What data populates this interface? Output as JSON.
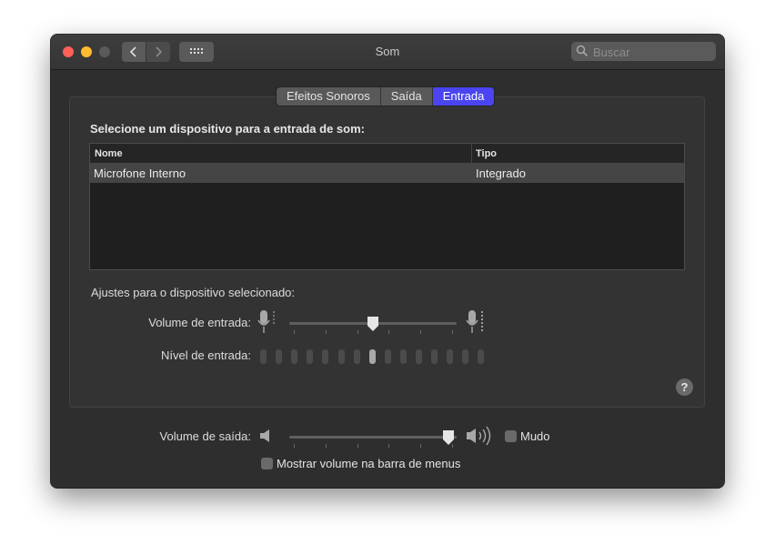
{
  "window": {
    "title": "Som"
  },
  "search": {
    "placeholder": "Buscar"
  },
  "tabs": [
    {
      "label": "Efeitos Sonoros",
      "active": false
    },
    {
      "label": "Saída",
      "active": false
    },
    {
      "label": "Entrada",
      "active": true
    }
  ],
  "input": {
    "heading": "Selecione um dispositivo para a entrada de som:",
    "table": {
      "columns": [
        "Nome",
        "Tipo"
      ],
      "rows": [
        {
          "name": "Microfone Interno",
          "type": "Integrado"
        }
      ]
    },
    "adjust_heading": "Ajustes para o dispositivo selecionado:",
    "volume_label": "Volume de entrada:",
    "volume_value": 0.5,
    "level_label": "Nível de entrada:",
    "level_segments": 15,
    "level_active_index": 7
  },
  "output": {
    "volume_label": "Volume de saída:",
    "volume_value": 0.95,
    "mute_label": "Mudo",
    "mute_checked": false,
    "show_volume_label": "Mostrar volume na barra de menus",
    "show_volume_checked": false
  },
  "icons": {
    "close": "close-icon",
    "minimize": "minimize-icon",
    "zoom": "zoom-icon",
    "back": "chevron-left-icon",
    "forward": "chevron-right-icon",
    "grid": "grid-icon",
    "search": "search-icon",
    "help": "help-icon",
    "mic": "microphone-icon",
    "speaker": "speaker-icon"
  },
  "help_glyph": "?",
  "colors": {
    "accent": "#4a45f0",
    "window_bg": "#2e2e2e",
    "titlebar": "#3a3a3a"
  }
}
